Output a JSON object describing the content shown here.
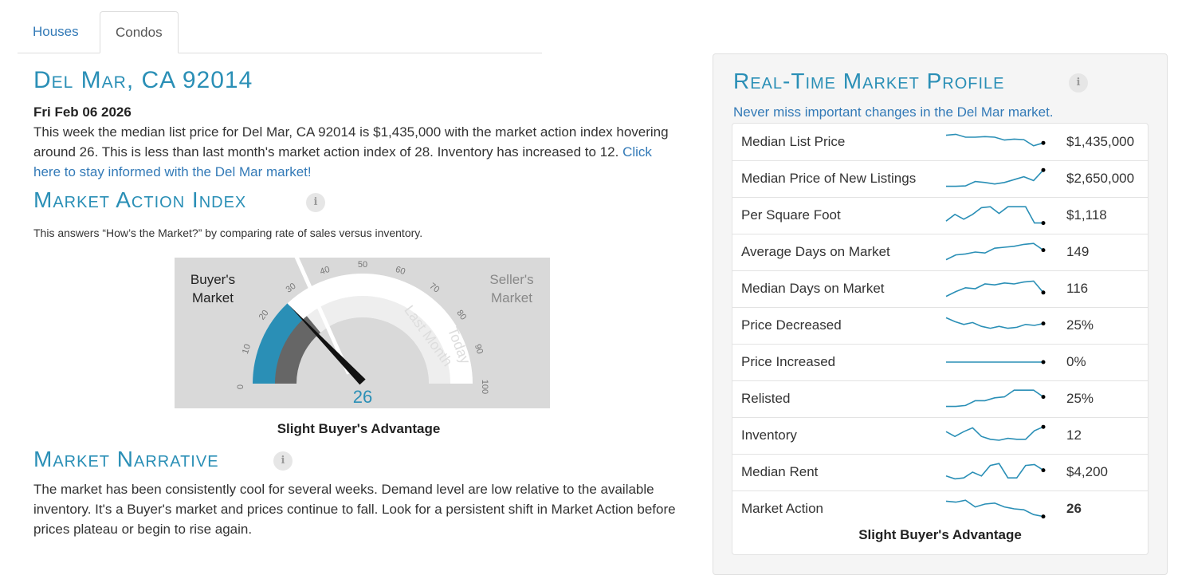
{
  "tabs": [
    {
      "label": "Houses",
      "active": false
    },
    {
      "label": "Condos",
      "active": true
    }
  ],
  "location_title": "Del Mar, CA 92014",
  "report_date": "Fri Feb 06 2026",
  "summary": {
    "text": "This week the median list price for Del Mar, CA 92014 is $1,435,000 with the market action index hovering around 26. This is less than last month's market action index of 28. Inventory has increased to 12. ",
    "link": "Click here to stay informed with the Del Mar market!"
  },
  "market_action": {
    "title": "Market Action Index",
    "info_icon": "info-icon",
    "description": "This answers “How’s the Market?” by comparing rate of sales versus inventory.",
    "gauge": {
      "buyers_label_1": "Buyer's",
      "buyers_label_2": "Market",
      "sellers_label_1": "Seller's",
      "sellers_label_2": "Market",
      "ticks": [
        "0",
        "10",
        "20",
        "30",
        "40",
        "50",
        "60",
        "70",
        "80",
        "90",
        "100"
      ],
      "value": 26,
      "value_text": "26",
      "last_month": 28,
      "last_month_label": "Last Month",
      "today_label": "Today",
      "colors": {
        "today": "#2a8fb6",
        "last_month": "#666666",
        "background": "#d9d9d9"
      }
    },
    "caption": "Slight Buyer's Advantage"
  },
  "narrative": {
    "title": "Market Narrative",
    "text": "The market has been consistently cool for several weeks. Demand level are low relative to the available inventory. It's a Buyer's market and prices continue to fall. Look for a persistent shift in Market Action before prices plateau or begin to rise again."
  },
  "profile": {
    "title": "Real-Time Market Profile",
    "subtitle": "Never miss important changes in the Del Mar market.",
    "spark_color": "#2a8fb6",
    "rows": [
      {
        "label": "Median List Price",
        "value": "$1,435,000",
        "trend": [
          0.85,
          0.9,
          0.75,
          0.75,
          0.78,
          0.75,
          0.6,
          0.65,
          0.62,
          0.3,
          0.45
        ]
      },
      {
        "label": "Median Price of New Listings",
        "value": "$2,650,000",
        "trend": [
          0.1,
          0.1,
          0.12,
          0.35,
          0.3,
          0.22,
          0.3,
          0.45,
          0.6,
          0.4,
          0.95
        ]
      },
      {
        "label": "Per Square Foot",
        "value": "$1,118",
        "trend": [
          0.2,
          0.55,
          0.3,
          0.55,
          0.9,
          0.95,
          0.6,
          0.95,
          0.95,
          0.95,
          0.1,
          0.1
        ]
      },
      {
        "label": "Average Days on Market",
        "value": "149",
        "trend": [
          0.1,
          0.35,
          0.4,
          0.5,
          0.45,
          0.7,
          0.75,
          0.8,
          0.9,
          0.95,
          0.6
        ]
      },
      {
        "label": "Median Days on Market",
        "value": "116",
        "trend": [
          0.1,
          0.35,
          0.55,
          0.5,
          0.75,
          0.7,
          0.8,
          0.75,
          0.85,
          0.9,
          0.3
        ]
      },
      {
        "label": "Price Decreased",
        "value": "25%",
        "trend": [
          0.9,
          0.7,
          0.55,
          0.65,
          0.45,
          0.35,
          0.45,
          0.35,
          0.4,
          0.55,
          0.5,
          0.6
        ]
      },
      {
        "label": "Price Increased",
        "value": "0%",
        "trend": [
          0.5,
          0.5,
          0.5,
          0.5,
          0.5,
          0.5,
          0.5,
          0.5,
          0.5,
          0.5,
          0.5
        ]
      },
      {
        "label": "Relisted",
        "value": "25%",
        "trend": [
          0.1,
          0.1,
          0.15,
          0.4,
          0.4,
          0.55,
          0.6,
          0.95,
          0.95,
          0.95,
          0.6
        ]
      },
      {
        "label": "Inventory",
        "value": "12",
        "trend": [
          0.7,
          0.45,
          0.7,
          0.9,
          0.45,
          0.3,
          0.25,
          0.35,
          0.3,
          0.3,
          0.75,
          0.95
        ]
      },
      {
        "label": "Median Rent",
        "value": "$4,200",
        "trend": [
          0.3,
          0.15,
          0.2,
          0.5,
          0.3,
          0.85,
          0.95,
          0.2,
          0.2,
          0.85,
          0.9,
          0.6
        ]
      },
      {
        "label": "Market Action",
        "value": "26",
        "trend": [
          0.9,
          0.85,
          0.95,
          0.6,
          0.75,
          0.8,
          0.6,
          0.5,
          0.45,
          0.2,
          0.1
        ]
      }
    ],
    "caption": "Slight Buyer's Advantage"
  }
}
